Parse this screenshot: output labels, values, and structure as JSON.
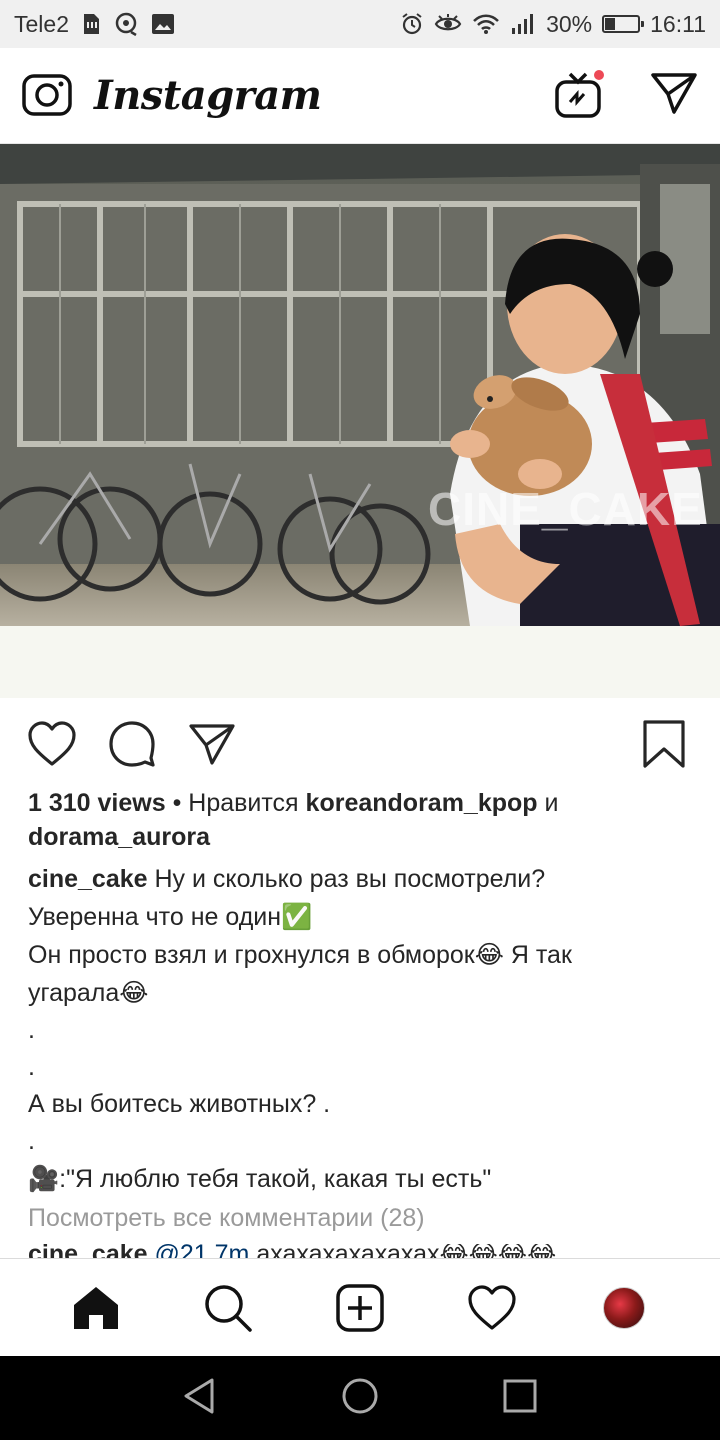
{
  "status_bar": {
    "carrier": "Tele2",
    "battery_percent": "30%",
    "battery_level": 0.3,
    "time": "16:11",
    "icons": [
      "sim-icon",
      "sync-icon",
      "image-icon",
      "alarm-icon",
      "eye-icon",
      "wifi-icon",
      "signal-icon",
      "battery-icon"
    ]
  },
  "header": {
    "brand": "Instagram",
    "icons": [
      "camera-icon",
      "igtv-icon",
      "direct-icon"
    ]
  },
  "post": {
    "watermark": "CINE_CAKE",
    "views": "1 310 views",
    "likes_prefix": "• Нравится",
    "liked_by_1": "koreandoram_kpop",
    "likes_and": "и",
    "liked_by_2": "dorama_aurora",
    "author": "cine_cake",
    "caption": {
      "line1": "Ну и сколько раз вы посмотрели?",
      "line2": "Уверенна что не один",
      "line2_emoji": "✅",
      "line3a": "Он просто взял и грохнулся в обморок",
      "line3_emoji": "😂",
      "line3b": "Я так",
      "line4": "угарала",
      "line4_emoji": "😂",
      "dot1": ".",
      "dot2": ".",
      "line5": "А вы боитесь животных? .",
      "dot3": ".",
      "line6_emoji": "🎥",
      "line6": ":\"Я люблю тебя такой, какая ты есть\""
    },
    "view_comments": "Посмотреть все комментарии (28)",
    "partial_comment": {
      "author": "cine_cake",
      "mention": "@21.7m",
      "text": "ахахахахахахах😂😂😂😂"
    }
  },
  "colors": {
    "accent_red": "#ed4956",
    "text": "#262626",
    "muted": "#999999"
  }
}
